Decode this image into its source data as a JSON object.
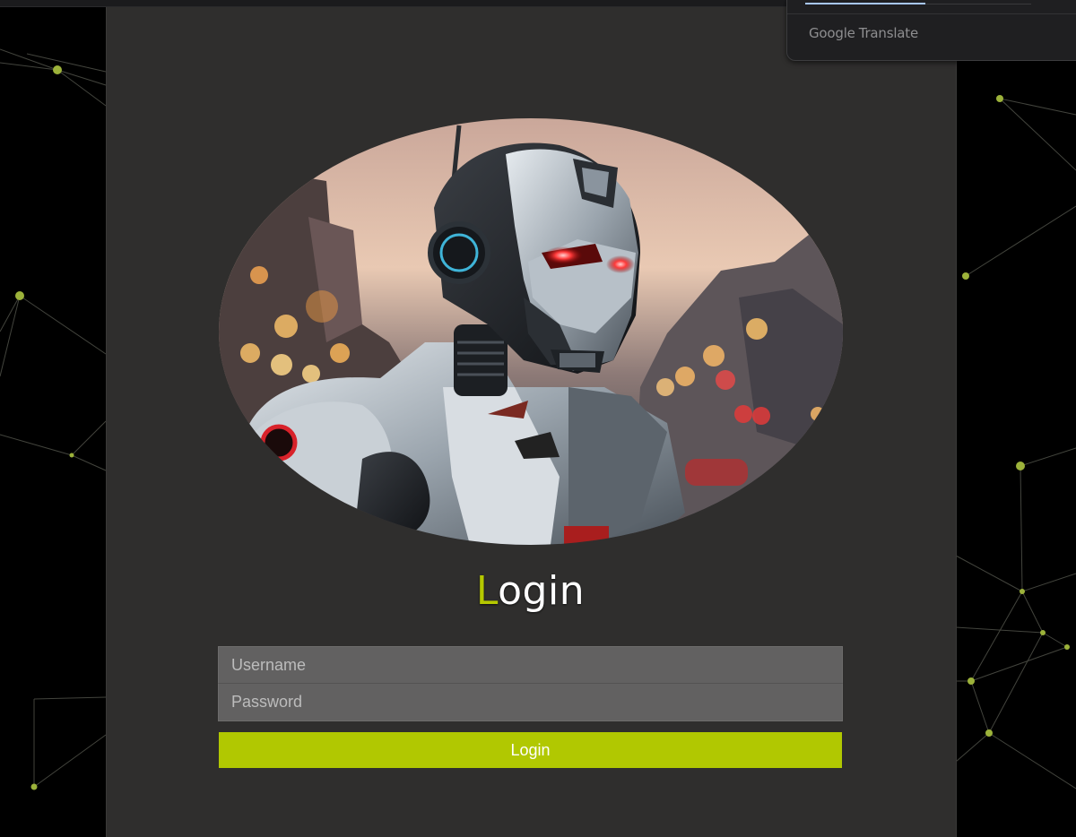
{
  "translate_popup": {
    "brand_google": "Google",
    "brand_translate": "Translate"
  },
  "login": {
    "title_first_letter": "L",
    "title_rest": "ogin",
    "username_placeholder": "Username",
    "password_placeholder": "Password",
    "button_label": "Login"
  },
  "colors": {
    "accent": "#b1c801",
    "panel_bg": "#2f2e2d",
    "input_bg": "#626161",
    "page_bg": "#000000"
  },
  "icons": {
    "hero_image": "robot-illustration"
  }
}
